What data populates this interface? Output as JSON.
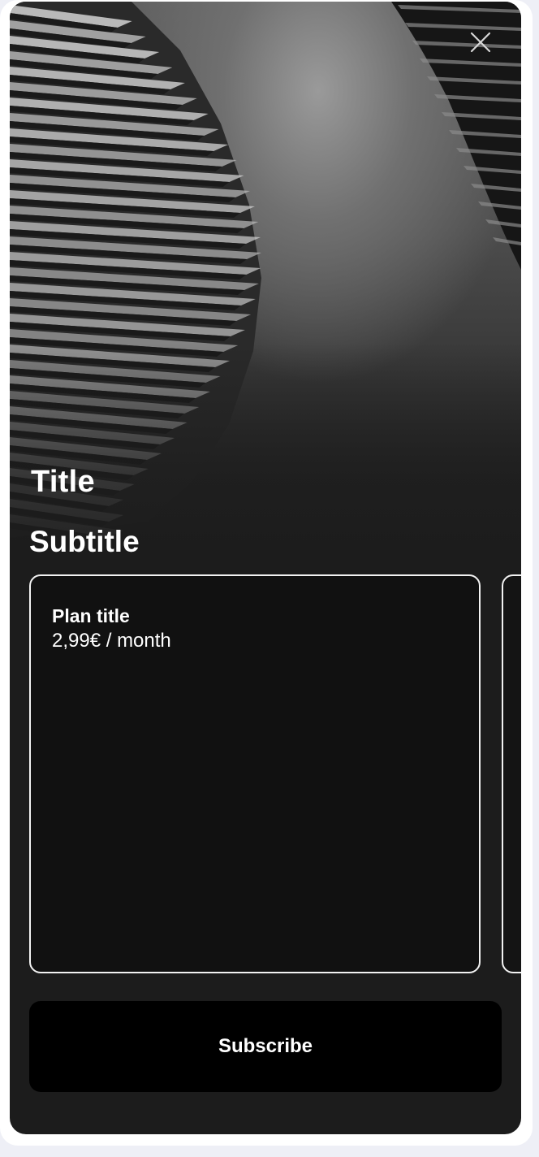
{
  "hero": {
    "title": "Title",
    "subtitle": "Subtitle",
    "image": "architecture-photo"
  },
  "close": {
    "icon": "close-icon"
  },
  "plans": [
    {
      "title": "Plan title",
      "price": "2,99€ / month",
      "selected": true
    },
    {
      "title": "",
      "price": "",
      "selected": false
    }
  ],
  "cta": {
    "label": "Subscribe"
  },
  "colors": {
    "background": "#1c1c1c",
    "card": "#111111",
    "card_border": "#f2f2f2",
    "button": "#000000",
    "text": "#ffffff"
  }
}
